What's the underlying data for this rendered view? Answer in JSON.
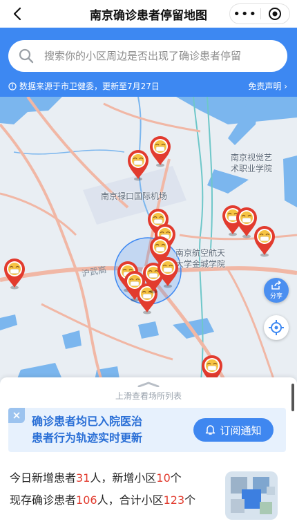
{
  "header": {
    "title": "南京确诊患者停留地图",
    "more_label": "•••"
  },
  "search": {
    "placeholder": "搜索你的小区周边是否出现了确诊患者停留"
  },
  "source": {
    "text": "数据来源于市卫健委，更新至7月27日",
    "disclaimer": "免责声明 ›"
  },
  "map": {
    "labels": {
      "airport": "南京禄口国际机场",
      "art_college_line1": "南京视觉艺",
      "art_college_line2": "术职业学院",
      "aero_college_line1": "南京航空航天",
      "aero_college_line2": "大学金城学院",
      "road": "沪武高"
    },
    "share_label": "分享",
    "colors": {
      "water": "#79b6ee",
      "road": "#f1b7a5",
      "pin": "#e23b2e",
      "accent": "#3d88f2"
    }
  },
  "sheet": {
    "swipe_hint": "上滑查看场所列表",
    "notice_line1": "确诊患者均已入院医治",
    "notice_line2": "患者行为轨迹实时更新",
    "subscribe_label": "订阅通知",
    "stats_line1": {
      "prefix": "今日新增患者",
      "patients": "31",
      "mid": "人，新增小区",
      "communities": "10",
      "suffix": "个"
    },
    "stats_line2": {
      "prefix": "现存确诊患者",
      "patients": "106",
      "mid": "人，合计小区",
      "communities": "123",
      "suffix": "个"
    }
  }
}
